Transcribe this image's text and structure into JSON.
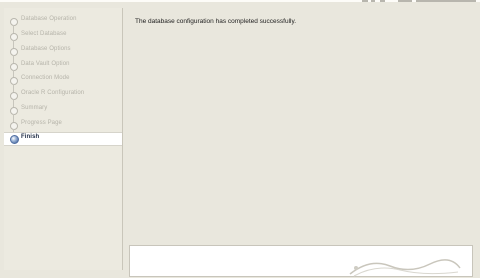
{
  "window": {
    "title": ""
  },
  "steps": [
    {
      "label": "Database Operation",
      "state": "done"
    },
    {
      "label": "Select Database",
      "state": "done"
    },
    {
      "label": "Database Options",
      "state": "done"
    },
    {
      "label": "Data Vault Option",
      "state": "done"
    },
    {
      "label": "Connection Mode",
      "state": "done"
    },
    {
      "label": "Oracle R Configuration",
      "state": "done"
    },
    {
      "label": "Summary",
      "state": "done"
    },
    {
      "label": "Progress Page",
      "state": "done"
    },
    {
      "label": "Finish",
      "state": "current"
    }
  ],
  "main": {
    "message": "The database configuration has completed successfully."
  },
  "colors": {
    "background": "#e9e7dd",
    "active_step": "#ffffff",
    "active_label": "#1e2b44",
    "inactive_label": "#b5b3a9"
  },
  "icons": {
    "step_done": "step-done-icon",
    "step_current": "step-current-icon"
  }
}
